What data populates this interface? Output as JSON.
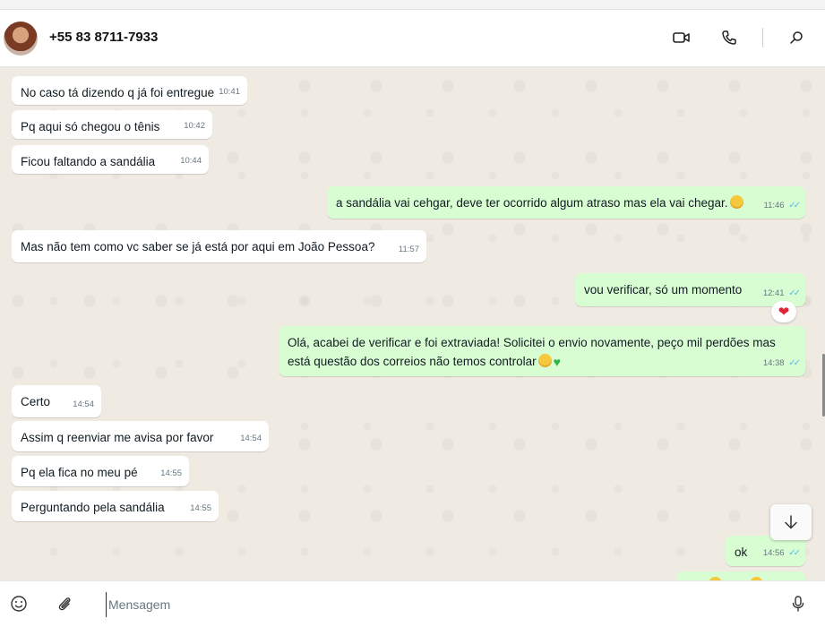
{
  "contact": {
    "name": "+55 83 8711-7933"
  },
  "header_icons": [
    "video-call-icon",
    "voice-call-icon",
    "search-icon"
  ],
  "messages": [
    {
      "dir": "in",
      "text": "No caso tá dizendo q já foi entregue",
      "time": "10:41"
    },
    {
      "dir": "in",
      "text": "Pq aqui só chegou o tênis",
      "time": "10:42"
    },
    {
      "dir": "in",
      "text": "Ficou faltando a sandália",
      "time": "10:44"
    },
    {
      "dir": "out",
      "text": "a sandália vai cehgar, deve ter ocorrido algum atraso mas ela vai chegar.",
      "emoji": "🤩",
      "time": "11:46",
      "read": true
    },
    {
      "dir": "in",
      "text": "Mas não tem como vc saber se já está por aqui em João Pessoa?",
      "time": "11:57"
    },
    {
      "dir": "out",
      "text": "vou verificar, só um momento",
      "time": "12:41",
      "read": true,
      "reaction": "❤"
    },
    {
      "dir": "out",
      "text_line1": "Olá, acabei de verificar e foi extraviada! Solicitei o envio novamente, peço mil perdões mas",
      "text_line2": "está questão dos correios não temos controlar",
      "emoji": "😔💚",
      "time": "14:38",
      "read": true
    },
    {
      "dir": "in",
      "text": "Certo",
      "time": "14:54"
    },
    {
      "dir": "in",
      "text": "Assim q reenviar me avisa por favor",
      "time": "14:54"
    },
    {
      "dir": "in",
      "text": "Pq ela fica no meu pé",
      "time": "14:55"
    },
    {
      "dir": "in",
      "text": "Perguntando pela sandália",
      "time": "14:55"
    },
    {
      "dir": "out",
      "text": "ok",
      "time": "14:56",
      "read": true
    }
  ],
  "read_ticks": "✓✓",
  "composer": {
    "placeholder": "Mensagem"
  },
  "colors": {
    "incoming": "#ffffff",
    "outgoing": "#d9fdd3",
    "ticks": "#53bdeb",
    "background": "#efeae2"
  }
}
